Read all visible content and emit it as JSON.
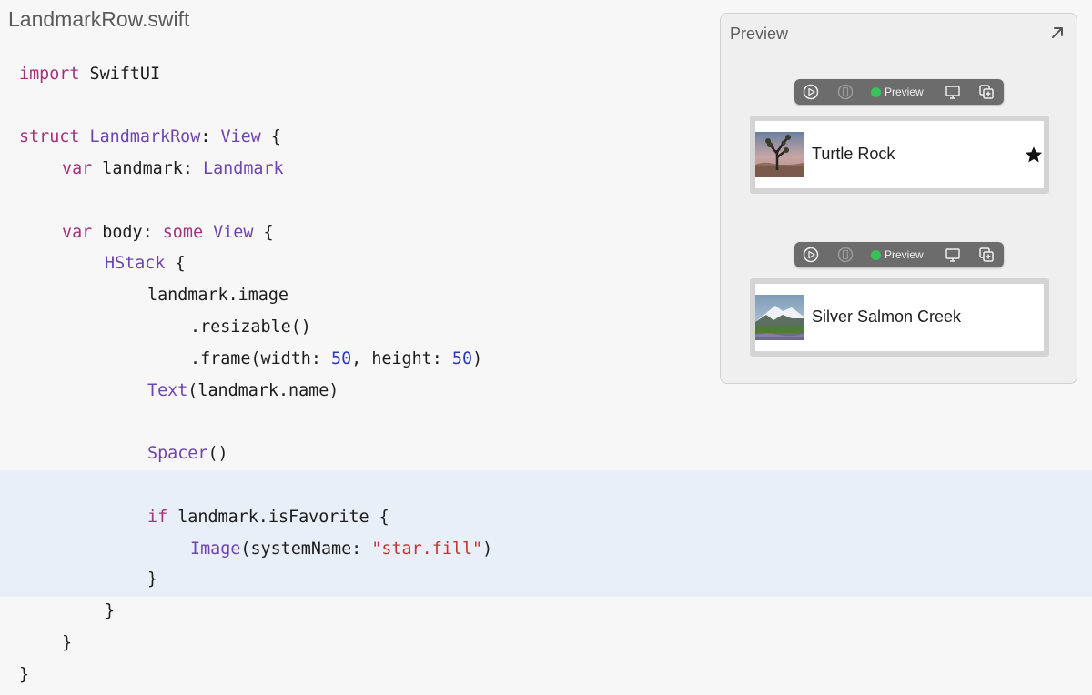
{
  "file_title": "LandmarkRow.swift",
  "code": {
    "l1_kw": "import",
    "l1_rest": " SwiftUI",
    "l2_kw": "struct",
    "l2_ty": " LandmarkRow",
    "l2_p": ":",
    "l2_ty2": " View",
    "l2_rest": " {",
    "l3_kw": "var",
    "l3_p": " landmark:",
    "l3_ty": " Landmark",
    "l4_kw": "var",
    "l4_p": " body:",
    "l4_kw2": " some",
    "l4_ty": " View",
    "l4_rest": " {",
    "l5_ty": "HStack",
    "l5_rest": " {",
    "l6": "landmark.image",
    "l7": ".resizable()",
    "l8_p1": ".frame(width: ",
    "l8_n1": "50",
    "l8_p2": ", height: ",
    "l8_n2": "50",
    "l8_p3": ")",
    "l9_ty": "Text",
    "l9_rest": "(landmark.name)",
    "l10_ty": "Spacer",
    "l10_rest": "()",
    "l11_kw": "if",
    "l11_rest": " landmark.isFavorite {",
    "l12_ty": "Image",
    "l12_p": "(systemName: ",
    "l12_str": "\"star.fill\"",
    "l12_rest": ")",
    "l13": "}",
    "l14": "}",
    "l15": "}",
    "l16": "}"
  },
  "preview": {
    "title": "Preview",
    "toolbar_live_label": "Preview",
    "rows": [
      {
        "name": "Turtle Rock",
        "is_favorite": true
      },
      {
        "name": "Silver Salmon Creek",
        "is_favorite": false
      }
    ]
  },
  "icons": {
    "expand": "arrow-up-right-icon",
    "live": "play-circle-icon",
    "device": "device-icon",
    "display": "display-icon",
    "duplicate": "duplicate-icon",
    "favorite": "star-fill-icon"
  },
  "colors": {
    "keyword": "#a3327d",
    "type": "#6e44b0",
    "number": "#2a37c7",
    "string": "#c8352e",
    "highlight": "#e8eff8",
    "live_dot": "#37c35a"
  }
}
